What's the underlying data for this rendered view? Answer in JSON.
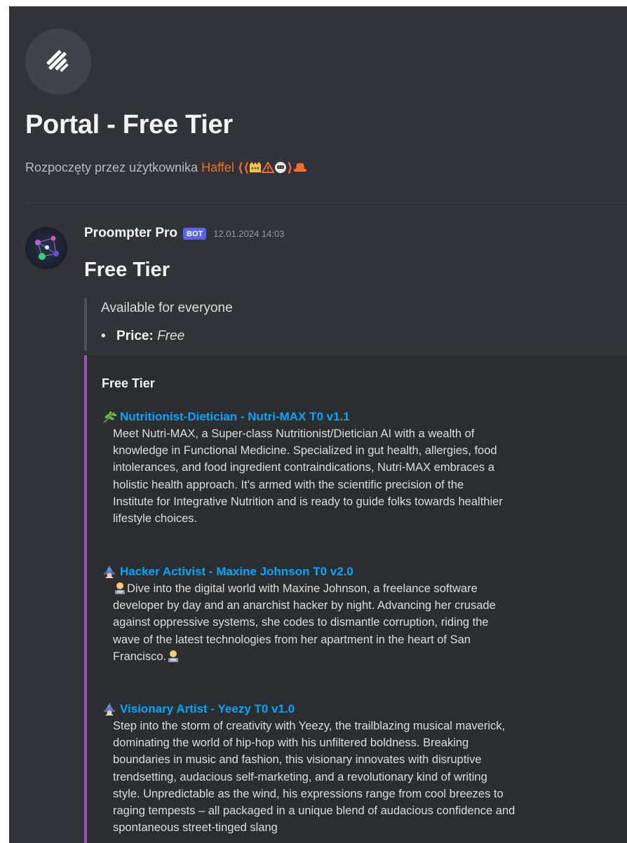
{
  "thread": {
    "icon": "thread-icon",
    "title": "Portal - Free Tier",
    "started_by_prefix": "Rozpoczęty przez użytkownika",
    "author": "Haffel",
    "author_decoration_open": "⟨⟨",
    "author_decoration_close": "⟩"
  },
  "message": {
    "author": "Proompter Pro",
    "bot_tag": "BOT",
    "timestamp": "12.01.2024 14:03",
    "heading": "Free Tier",
    "quote_text": "Available for everyone",
    "price_label": "Price:",
    "price_value": "Free"
  },
  "embed": {
    "accent_color": "#9b59b6",
    "title": "Free Tier",
    "fields": [
      {
        "icon": "herb-icon",
        "name": "Nutritionist-Dietician - Nutri-MAX T0 v1.1",
        "lines": [
          "Meet Nutri-MAX, a Super-class Nutritionist/Dietician AI with a wealth of",
          "knowledge in Functional Medicine. Specialized in gut health, allergies, food",
          "intolerances, and food ingredient contraindications, Nutri-MAX embraces a",
          "holistic health approach. It's armed with the scientific precision of the",
          "Institute for Integrative Nutrition and is ready to guide folks towards healthier",
          "lifestyle choices."
        ]
      },
      {
        "icon": "wizard-icon",
        "name": "Hacker Activist - Maxine Johnson T0 v2.0",
        "lines": [
          "Dive into the digital world with Maxine Johnson, a freelance software",
          "developer by day and an anarchist hacker by night. Advancing her crusade",
          "against oppressive systems, she codes to dismantle corruption, riding the",
          "wave of the latest technologies from her apartment in the heart of San",
          "Francisco."
        ]
      },
      {
        "icon": "wizard-icon",
        "name": "Visionary Artist - Yeezy T0 v1.0",
        "lines": [
          "Step into the storm of creativity with Yeezy, the trailblazing musical maverick,",
          "dominating the world of hip-hop with his unfiltered boldness. Breaking",
          "boundaries in music and fashion, this visionary innovates with disruptive",
          "trendsetting, audacious self-marketing, and a revolutionary kind of writing",
          "style. Unpredictable as the wind, his expressions range from cool breezes to",
          "raging tempests – all packaged in a unique blend of audacious confidence and",
          "spontaneous street-tinged slang"
        ]
      }
    ]
  }
}
